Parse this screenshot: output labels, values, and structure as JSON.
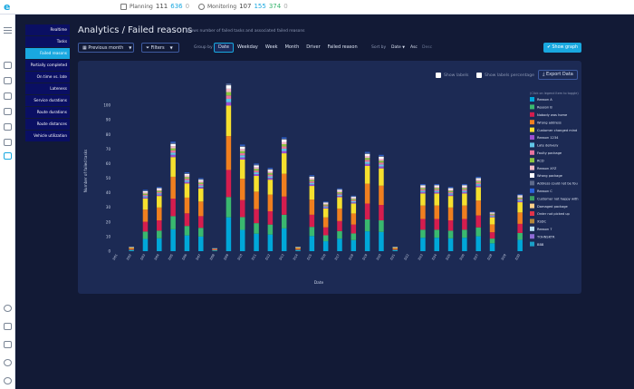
{
  "topbar": {
    "planning_label": "Planning",
    "planning_a": "111",
    "planning_b": "636",
    "planning_c": "0",
    "monitoring_label": "Monitoring",
    "monitoring_a": "107",
    "monitoring_b": "155",
    "monitoring_c": "374",
    "monitoring_d": "0"
  },
  "submenu": [
    {
      "label": "Realtime",
      "active": false
    },
    {
      "label": "Tasks",
      "active": false
    },
    {
      "label": "Failed reasons",
      "active": true
    },
    {
      "label": "Partially completed",
      "active": false
    },
    {
      "label": "On time vs. late",
      "active": false
    },
    {
      "label": "Lateness",
      "active": false
    },
    {
      "label": "Service durations",
      "active": false
    },
    {
      "label": "Route durations",
      "active": false
    },
    {
      "label": "Route distances",
      "active": false
    },
    {
      "label": "Vehicle utilization",
      "active": false
    }
  ],
  "header": {
    "title": "Analytics / Failed reasons",
    "subtitle": "Shows number of failed tasks and associated failed reasons"
  },
  "controls": {
    "period": "Previous month",
    "filters": "Filters",
    "group_by_label": "Group by",
    "group_by_options": [
      "Date",
      "Weekday",
      "Week",
      "Month",
      "Driver",
      "Failed reason"
    ],
    "group_by_selected": "Date",
    "sort_by_label": "Sort by",
    "sort_by_value": "Date",
    "sort_asc": "Asc",
    "sort_desc": "Desc",
    "show_graph": "Show graph",
    "show_labels": "Show labels",
    "show_labels_pct": "Show labels percentage",
    "export": "Export Data"
  },
  "chart_data": {
    "type": "bar",
    "stacked": true,
    "title": "",
    "xlabel": "Date",
    "ylabel": "Number of failed tasks",
    "ylim": [
      0,
      110
    ],
    "yticks": [
      0,
      10,
      20,
      30,
      40,
      50,
      60,
      70,
      80,
      90,
      100
    ],
    "legend_hint": "(Click on legend item to toggle)",
    "categories": [
      "D01",
      "D02",
      "D03",
      "D04",
      "D05",
      "D06",
      "D07",
      "D08",
      "D09",
      "D10",
      "D11",
      "D12",
      "D13",
      "D14",
      "D15",
      "D16",
      "D17",
      "D18",
      "D19",
      "D20",
      "D21",
      "D22",
      "D23",
      "D24",
      "D25",
      "D26",
      "D27",
      "D28",
      "D29",
      "D30",
      "D31",
      "D32",
      "D33",
      "D34",
      "D35",
      "D36",
      "D37",
      "D38",
      "D39",
      "D40",
      "D41",
      "D42",
      "D43",
      "D44",
      "D45",
      "D46",
      "D47",
      "D48",
      "D49",
      "D50"
    ],
    "totals": [
      0,
      0,
      3,
      0,
      42,
      0,
      44,
      0,
      75,
      0,
      54,
      0,
      50,
      0,
      2,
      0,
      116,
      0,
      73,
      0,
      60,
      0,
      57,
      0,
      78,
      0,
      3,
      0,
      52,
      0,
      34,
      0,
      43,
      0,
      38,
      0,
      68,
      0,
      66,
      0,
      3,
      0,
      0,
      0,
      46,
      0,
      46,
      0,
      44,
      0,
      46,
      0,
      51,
      0,
      27,
      0,
      0,
      0,
      39
    ],
    "series": [
      {
        "name": "Reason A",
        "color": "#00a7d9"
      },
      {
        "name": "Reason B",
        "color": "#3ab86f"
      },
      {
        "name": "Nobody was home",
        "color": "#d51d4e"
      },
      {
        "name": "Wrong address",
        "color": "#f07f1f"
      },
      {
        "name": "Customer changed mind",
        "color": "#f6e02e"
      },
      {
        "name": "Reason 1234",
        "color": "#9b4fd1"
      },
      {
        "name": "Late delivery",
        "color": "#60c7e8"
      },
      {
        "name": "Faulty package",
        "color": "#e7749f"
      },
      {
        "name": "RCD",
        "color": "#8cc63f"
      },
      {
        "name": "Reason XYZ",
        "color": "#f4b9c7"
      },
      {
        "name": "Wrong package",
        "color": "#ffffff"
      },
      {
        "name": "Address could not be fou",
        "color": "#5e6b8c"
      },
      {
        "name": "Reason C",
        "color": "#2b63d9"
      },
      {
        "name": "Customer not happy with",
        "color": "#3a9f62"
      },
      {
        "name": "Damaged package",
        "color": "#ffd18a"
      },
      {
        "name": "Order not picked up",
        "color": "#e0334a"
      },
      {
        "name": "XSDC",
        "color": "#b3863a"
      },
      {
        "name": "Reason 7",
        "color": "#b8e0f6"
      },
      {
        "name": "TOHNSKTR",
        "color": "#8e6bd6"
      },
      {
        "name": "BBB",
        "color": "#1aa0c8"
      }
    ]
  }
}
